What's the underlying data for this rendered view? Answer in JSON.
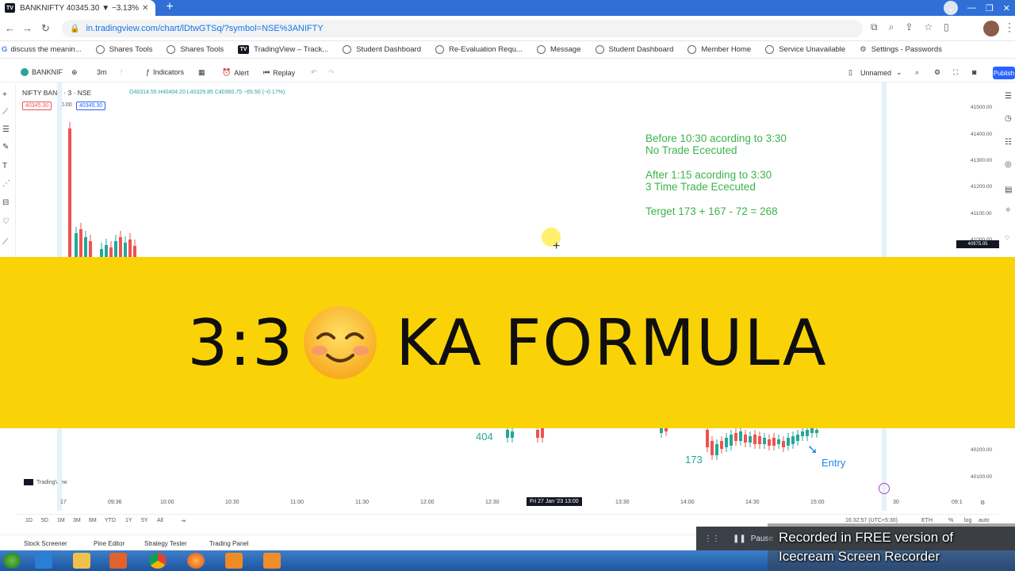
{
  "browser": {
    "tab_title": "BANKNIFTY 40345.30 ▼ −3.13%",
    "url": "in.tradingview.com/chart/lDtwGTSq/?symbol=NSE%3ANIFTY"
  },
  "bookmarks": [
    {
      "label": "discuss the meanin...",
      "icon": "google-icon"
    },
    {
      "label": "Shares Tools",
      "icon": "globe-icon"
    },
    {
      "label": "Shares Tools",
      "icon": "globe-icon"
    },
    {
      "label": "TradingView – Track...",
      "icon": "tradingview-icon"
    },
    {
      "label": "Student Dashboard",
      "icon": "globe-icon"
    },
    {
      "label": "Re-Evaluation Requ...",
      "icon": "globe-icon"
    },
    {
      "label": "Message",
      "icon": "globe-icon"
    },
    {
      "label": "Student Dashboard",
      "icon": "globe-icon"
    },
    {
      "label": "Member Home",
      "icon": "globe-icon"
    },
    {
      "label": "Service Unavailable",
      "icon": "globe-icon"
    },
    {
      "label": "Settings - Passwords",
      "icon": "gear-icon"
    }
  ],
  "toolbar": {
    "symbol": "BANKNIF",
    "interval": "3m",
    "indicators": "Indicators",
    "alert": "Alert",
    "replay": "Replay",
    "layout": "Unnamed",
    "publish": "Publish"
  },
  "legend": {
    "title": "NIFTY BANK · 3 · NSE",
    "ohlc": "O40314.55 H40404.20 L40329.85 C40360.75 −65.50 (−0.17%)",
    "price_sell": "40345.30",
    "price_mid": "0.00",
    "price_buy": "40345.30"
  },
  "notes": {
    "line1": "Before 10:30 acording to 3:30",
    "line2": "No Trade Ececuted",
    "line3": "After 1:15 acording to 3:30",
    "line4": "3 Time Trade Ececuted",
    "line5": "Terget 173 + 167 - 72 = 268"
  },
  "annotations": {
    "left_number": "404",
    "mid_number": "173",
    "entry": "Entry"
  },
  "yaxis_ticks": [
    "41500.00",
    "41400.00",
    "41300.00",
    "41200.00",
    "41100.00",
    "41000.00",
    "40200.00",
    "40100.00"
  ],
  "price_tag": "40975.05",
  "xaxis_ticks": [
    "17",
    "09:36",
    "10:00",
    "10:30",
    "11:00",
    "11:30",
    "12:00",
    "12:30",
    "13:30",
    "14:00",
    "14:30",
    "15:00",
    "30",
    "09:1"
  ],
  "xaxis_highlight": "Fri 27 Jan '23  13:00",
  "timeframes": [
    "1D",
    "5D",
    "1M",
    "3M",
    "6M",
    "YTD",
    "1Y",
    "5Y",
    "All"
  ],
  "status_right": "16:32:57 (UTC+5:30)",
  "status_items": [
    "ETH",
    "%",
    "log",
    "auto"
  ],
  "panel_tabs": [
    "Stock Screener",
    "Pine Editor",
    "Strategy Tester",
    "Trading Panel"
  ],
  "tradingview_label": "TradingView",
  "banner": {
    "left": "3:3",
    "right": "KA FORMULA",
    "emoji": "smiling-face-icon"
  },
  "recorder": {
    "pause": "Pause",
    "watermark_line1": "Recorded in FREE version of",
    "watermark_line2": "Icecream  Screen  Recorder"
  },
  "colors": {
    "banner_bg": "#f9d308",
    "note_green": "#3cb44b",
    "annotation_green": "#26a69a",
    "entry_blue": "#1e88e5",
    "bear": "#ef5350",
    "bull": "#26a69a"
  }
}
